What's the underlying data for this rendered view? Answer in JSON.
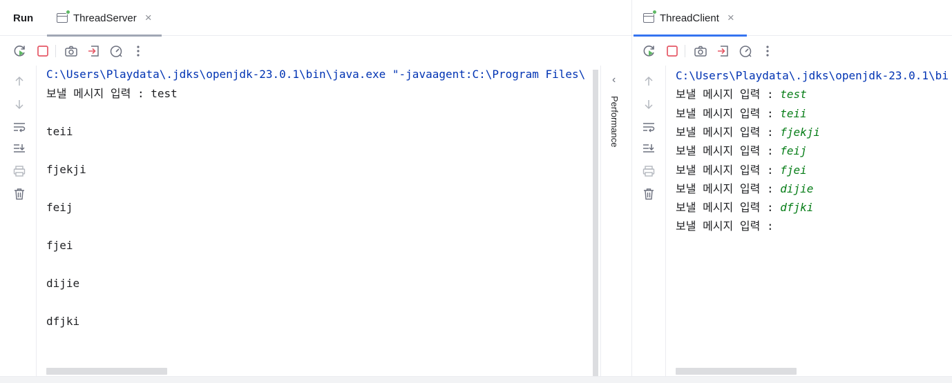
{
  "run_panel": {
    "title": "Run"
  },
  "left": {
    "tab": {
      "label": "ThreadServer",
      "close": "×"
    },
    "console_lines": [
      {
        "text": "C:\\Users\\Playdata\\.jdks\\openjdk-23.0.1\\bin\\java.exe \"-javaagent:C:\\Program Files\\",
        "style": "cmd"
      },
      {
        "text": "보낼 메시지 입력 : test",
        "style": "plain"
      },
      {
        "text": "",
        "style": "plain"
      },
      {
        "text": "teii",
        "style": "plain"
      },
      {
        "text": "",
        "style": "plain"
      },
      {
        "text": "fjekji",
        "style": "plain"
      },
      {
        "text": "",
        "style": "plain"
      },
      {
        "text": "feij",
        "style": "plain"
      },
      {
        "text": "",
        "style": "plain"
      },
      {
        "text": "fjei",
        "style": "plain"
      },
      {
        "text": "",
        "style": "plain"
      },
      {
        "text": "dijie",
        "style": "plain"
      },
      {
        "text": "",
        "style": "plain"
      },
      {
        "text": "dfjki",
        "style": "plain"
      }
    ]
  },
  "performance": {
    "label": "Performance"
  },
  "right": {
    "tab": {
      "label": "ThreadClient",
      "close": "×"
    },
    "console_lines": [
      {
        "prompt": "C:\\Users\\Playdata\\.jdks\\openjdk-23.0.1\\bi",
        "input": "",
        "style": "cmd"
      },
      {
        "prompt": "보낼 메시지 입력 : ",
        "input": "test",
        "style": "plain"
      },
      {
        "prompt": "보낼 메시지 입력 : ",
        "input": "teii",
        "style": "plain"
      },
      {
        "prompt": "보낼 메시지 입력 : ",
        "input": "fjekji",
        "style": "plain"
      },
      {
        "prompt": "보낼 메시지 입력 : ",
        "input": "feij",
        "style": "plain"
      },
      {
        "prompt": "보낼 메시지 입력 : ",
        "input": "fjei",
        "style": "plain"
      },
      {
        "prompt": "보낼 메시지 입력 : ",
        "input": "dijie",
        "style": "plain"
      },
      {
        "prompt": "보낼 메시지 입력 : ",
        "input": "dfjki",
        "style": "plain"
      },
      {
        "prompt": "보낼 메시지 입력 : ",
        "input": "",
        "style": "plain"
      }
    ]
  },
  "colors": {
    "accent": "#3574f0",
    "inactive_tab_underline": "#a0a7b4",
    "rerun_green": "#5fb865",
    "stop_red": "#e55765",
    "command_blue": "#0033b3",
    "user_input_green": "#067d17"
  },
  "icons": [
    "rerun-icon",
    "stop-icon",
    "camera-icon",
    "exit-icon",
    "speedometer-icon",
    "more-icon",
    "arrow-up-icon",
    "arrow-down-icon",
    "soft-wrap-icon",
    "scroll-to-end-icon",
    "print-icon",
    "trash-icon",
    "chevron-left-icon"
  ]
}
